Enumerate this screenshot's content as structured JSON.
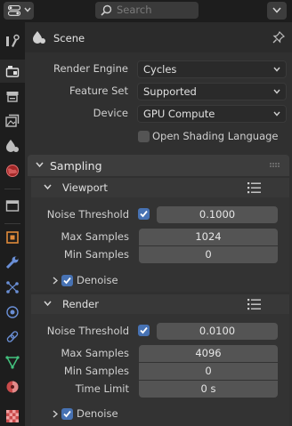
{
  "header": {
    "search_placeholder": "Search",
    "editor_type_icon": "properties-editor-icon",
    "options_icon": "chevron-down-icon"
  },
  "sidebar": {
    "tabs": [
      {
        "name": "tool",
        "icon": "tool-icon",
        "active": false
      },
      {
        "name": "render",
        "icon": "render-icon",
        "active": true
      },
      {
        "name": "output",
        "icon": "output-icon",
        "active": false
      },
      {
        "name": "view-layer",
        "icon": "view-layer-icon",
        "active": false
      },
      {
        "name": "scene",
        "icon": "scene-icon",
        "active": false
      },
      {
        "name": "world",
        "icon": "world-icon",
        "active": false
      },
      {
        "name": "collection",
        "icon": "collection-icon",
        "active": false
      },
      {
        "name": "object",
        "icon": "object-icon",
        "active": false
      },
      {
        "name": "modifiers",
        "icon": "wrench-icon",
        "active": false
      },
      {
        "name": "particles",
        "icon": "particles-icon",
        "active": false
      },
      {
        "name": "physics",
        "icon": "physics-icon",
        "active": false
      },
      {
        "name": "constraints",
        "icon": "constraints-icon",
        "active": false
      },
      {
        "name": "data",
        "icon": "mesh-data-icon",
        "active": false
      },
      {
        "name": "material",
        "icon": "material-icon",
        "active": false
      },
      {
        "name": "texture",
        "icon": "texture-icon",
        "active": false
      }
    ]
  },
  "breadcrumb": {
    "label": "Scene"
  },
  "render": {
    "engine_label": "Render Engine",
    "engine_value": "Cycles",
    "feature_set_label": "Feature Set",
    "feature_set_value": "Supported",
    "device_label": "Device",
    "device_value": "GPU Compute",
    "osl_label": "Open Shading Language",
    "osl_checked": false
  },
  "sampling": {
    "title": "Sampling",
    "viewport": {
      "title": "Viewport",
      "noise_threshold_label": "Noise Threshold",
      "noise_threshold_enabled": true,
      "noise_threshold_value": "0.1000",
      "max_samples_label": "Max Samples",
      "max_samples_value": "1024",
      "min_samples_label": "Min Samples",
      "min_samples_value": "0",
      "denoise_label": "Denoise",
      "denoise_checked": true
    },
    "render": {
      "title": "Render",
      "noise_threshold_label": "Noise Threshold",
      "noise_threshold_enabled": true,
      "noise_threshold_value": "0.0100",
      "max_samples_label": "Max Samples",
      "max_samples_value": "4096",
      "min_samples_label": "Min Samples",
      "min_samples_value": "0",
      "time_limit_label": "Time Limit",
      "time_limit_value": "0 s",
      "denoise_label": "Denoise",
      "denoise_checked": true
    }
  },
  "colors": {
    "accent": "#4772b3",
    "field": "#545454",
    "panel_header": "#3d3d3d",
    "background": "#303030"
  }
}
